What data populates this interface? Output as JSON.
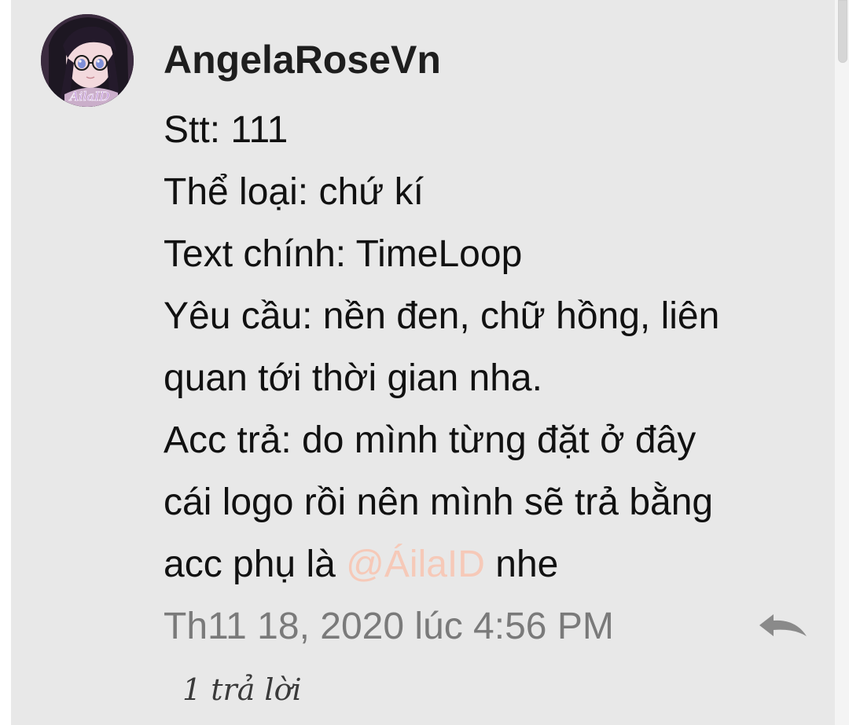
{
  "comment": {
    "author": "AngelaRoseVn",
    "avatar_icon": "avatar-anime-girl-icon",
    "avatar_logo_text": "AilaID",
    "lines": {
      "stt": "Stt: 111",
      "the_loai": "Thể loại: chứ kí",
      "text_chinh": "Text chính: TimeLoop",
      "yeu_cau_1": "Yêu cầu: nền đen, chữ hồng, liên",
      "yeu_cau_2": "quan tới thời gian nha.",
      "acc_tra_1": "Acc trả: do mình từng đặt ở đây",
      "acc_tra_2": "cái logo rồi nên mình sẽ trả bằng",
      "acc_tra_3_prefix": "acc phụ là ",
      "acc_tra_3_mention": "@ÁilaID",
      "acc_tra_3_suffix": " nhe"
    },
    "timestamp": "Th11 18, 2020 lúc 4:56 PM",
    "reply_icon": "reply-arrow-icon",
    "reply_count": "1 trả lời"
  },
  "colors": {
    "card_background": "#e8e8e8",
    "mention": "#f6c9b8",
    "timestamp": "#7a7a7a"
  }
}
